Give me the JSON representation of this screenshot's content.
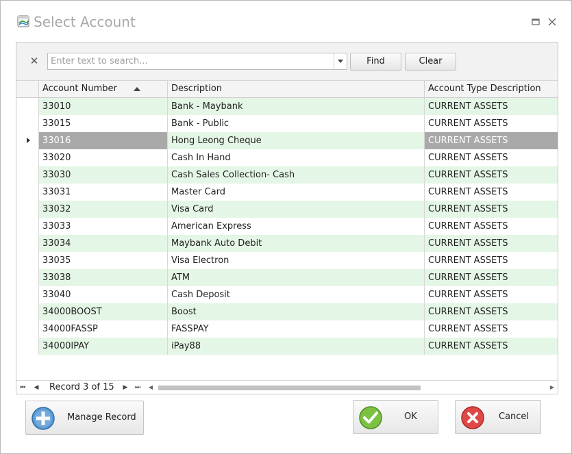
{
  "window": {
    "title": "Select Account",
    "maximize_label": "□",
    "close_label": "✕"
  },
  "search": {
    "clear_glyph": "✕",
    "placeholder": "Enter text to search...",
    "find_label": "Find",
    "clear_label": "Clear"
  },
  "grid": {
    "columns": [
      "Account Number",
      "Description",
      "Account Type Description"
    ],
    "sort_column": "Account Number",
    "sort_direction": "ascending",
    "selected_row": 2,
    "rows": [
      {
        "account": "33010",
        "description": "Bank - Maybank",
        "type": "CURRENT ASSETS"
      },
      {
        "account": "33015",
        "description": "Bank - Public",
        "type": "CURRENT ASSETS"
      },
      {
        "account": "33016",
        "description": "Hong Leong Cheque",
        "type": "CURRENT ASSETS"
      },
      {
        "account": "33020",
        "description": "Cash In Hand",
        "type": "CURRENT ASSETS"
      },
      {
        "account": "33030",
        "description": "Cash Sales Collection- Cash",
        "type": "CURRENT ASSETS"
      },
      {
        "account": "33031",
        "description": "Master Card",
        "type": "CURRENT ASSETS"
      },
      {
        "account": "33032",
        "description": "Visa Card",
        "type": "CURRENT ASSETS"
      },
      {
        "account": "33033",
        "description": "American Express",
        "type": "CURRENT ASSETS"
      },
      {
        "account": "33034",
        "description": "Maybank Auto Debit",
        "type": "CURRENT ASSETS"
      },
      {
        "account": "33035",
        "description": "Visa Electron",
        "type": "CURRENT ASSETS"
      },
      {
        "account": "33038",
        "description": "ATM",
        "type": "CURRENT ASSETS"
      },
      {
        "account": "33040",
        "description": "Cash Deposit",
        "type": "CURRENT ASSETS"
      },
      {
        "account": "34000BOOST",
        "description": "Boost",
        "type": "CURRENT ASSETS"
      },
      {
        "account": "34000FASSP",
        "description": "FASSPAY",
        "type": "CURRENT ASSETS"
      },
      {
        "account": "34000IPAY",
        "description": "iPay88",
        "type": "CURRENT ASSETS"
      }
    ]
  },
  "navigator": {
    "first_glyph": "⏮",
    "prev_glyph": "◀",
    "next_glyph": "▶",
    "last_glyph": "⏭",
    "record_text": "Record 3 of 15",
    "scroll_left_glyph": "◀",
    "scroll_right_glyph": "▶"
  },
  "buttons": {
    "manage_label": "Manage Record",
    "ok_label": "OK",
    "cancel_label": "Cancel"
  },
  "colors": {
    "row_alt": "#e4f6e5",
    "row_plain": "#ffffff",
    "row_selected": "#a9a9a9",
    "selected_text": "#ffffff",
    "title_text": "#a8a8a8"
  }
}
